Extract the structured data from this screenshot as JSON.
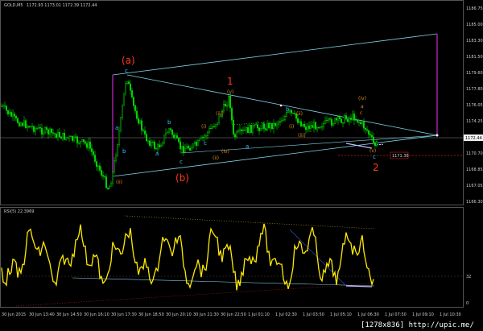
{
  "window": {
    "title": "GOLD,M5",
    "ohlc": "1172.93 1173.01 1172.39 1172.44"
  },
  "rsi": {
    "title": "RSI(5) 22.3969",
    "level_mark": "32",
    "zero_mark": "0"
  },
  "price_axis": [
    "1186.75",
    "1185.00",
    "1183.30",
    "1181.50",
    "1179.60",
    "1177.80",
    "1176.05",
    "1174.25",
    "1172.44",
    "1170.70",
    "1168.85",
    "1167.05",
    "1166.30"
  ],
  "time_axis": [
    "30 Jun 2015",
    "30 Jun 13:40",
    "30 Jun 14:50",
    "30 Jun 16:10",
    "30 Jun 17:30",
    "30 Jun 18:50",
    "30 Jun 20:10",
    "30 Jun 21:30",
    "30 Jun 22:50",
    "1 Jul 01:10",
    "1 Jul 02:30",
    "1 Jul 03:50",
    "1 Jul 05:10",
    "1 Jul 06:30",
    "1 Jul 07:50",
    "1 Jul 09:10",
    "1 Jul 10:30"
  ],
  "price_tag": "1172.44",
  "level_tag": "1171.36",
  "wave_labels": {
    "big_a": "(a)",
    "big_b": "(b)",
    "one": "1",
    "two": "2",
    "c_top": "c",
    "a1": "a",
    "b1": "b",
    "c1": "c",
    "a2": "a",
    "b2": "b",
    "c2": "c",
    "a3": "a",
    "b3": "b",
    "a4": "a",
    "c4": "c",
    "ii": "(ii)",
    "iii": "(iii)",
    "iv": "(iv)",
    "v": "(v)",
    "i": "(i)",
    "ii_b": "(ii)",
    "iii_b": "(iii)",
    "iv_b": "(iv)",
    "v_b": "(v)",
    "i_b": "(i)",
    "ii_c": "(ii)",
    "iii_c": "(iii)",
    "v_c": "(v)",
    "c_end": "c"
  },
  "watermark": "[1278x836] http://upic.me/",
  "colors": {
    "background": "#000000",
    "bull_candle": "#00e000",
    "bear_candle": "#00e000",
    "rsi_line": "#ffea00",
    "channel": "#7fd3e6",
    "magenta": "#b021b0",
    "red_label": "#ff3a1a",
    "blue_label": "#2ec6ff",
    "orange_label": "#e08a1a"
  }
}
